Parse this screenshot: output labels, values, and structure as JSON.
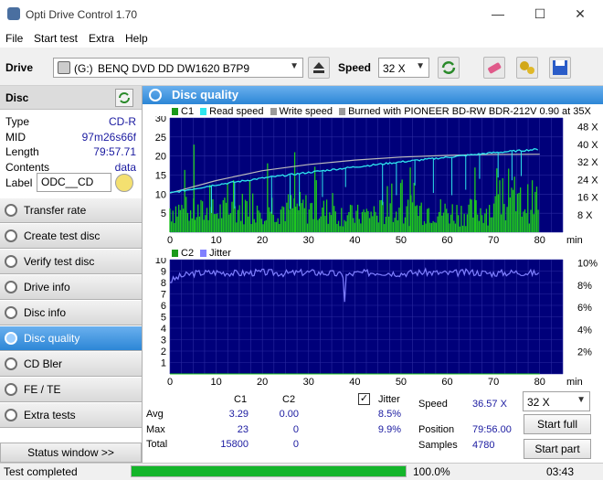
{
  "window": {
    "title": "Opti Drive Control 1.70",
    "minimize": "—",
    "maximize": "☐",
    "close": "✕"
  },
  "menu": [
    "File",
    "Start test",
    "Extra",
    "Help"
  ],
  "toolbar": {
    "drive_label": "Drive",
    "drive_letter": "(G:)",
    "drive_name": "BENQ DVD DD DW1620 B7P9",
    "speed_label": "Speed",
    "speed_value": "32 X"
  },
  "disc": {
    "header": "Disc",
    "rows": [
      {
        "key": "Type",
        "value": "CD-R"
      },
      {
        "key": "MID",
        "value": "97m26s66f"
      },
      {
        "key": "Length",
        "value": "79:57.71"
      },
      {
        "key": "Contents",
        "value": "data"
      }
    ],
    "label_key": "Label",
    "label_value": "ODC__CD"
  },
  "nav": [
    {
      "label": "Transfer rate",
      "active": false
    },
    {
      "label": "Create test disc",
      "active": false
    },
    {
      "label": "Verify test disc",
      "active": false
    },
    {
      "label": "Drive info",
      "active": false
    },
    {
      "label": "Disc info",
      "active": false
    },
    {
      "label": "Disc quality",
      "active": true
    },
    {
      "label": "CD Bler",
      "active": false
    },
    {
      "label": "FE / TE",
      "active": false
    },
    {
      "label": "Extra tests",
      "active": false
    }
  ],
  "status_window": "Status window >>",
  "panel_title": "Disc quality",
  "legend1": {
    "c1": "C1",
    "read": "Read speed",
    "write": "Write speed",
    "burned": "Burned with PIONEER BD-RW   BDR-212V 0.90 at 35X"
  },
  "legend2": {
    "c2": "C2",
    "jitter": "Jitter"
  },
  "chart_data": [
    {
      "type": "bar",
      "title": "",
      "xlabel": "min",
      "xlim": [
        0,
        80
      ],
      "ylim": [
        0,
        30
      ],
      "x_ticks": [
        0,
        10,
        20,
        30,
        40,
        50,
        60,
        70,
        80
      ],
      "y_ticks": [
        5,
        10,
        15,
        20,
        25,
        30
      ],
      "y2_ticks": [
        "8 X",
        "16 X",
        "24 X",
        "32 X",
        "40 X",
        "48 X"
      ],
      "y2lim": [
        0,
        52
      ],
      "series": [
        {
          "name": "C1",
          "color": "#1ec81e",
          "x": [
            0,
            5,
            10,
            15,
            20,
            25,
            30,
            35,
            40,
            45,
            50,
            55,
            60,
            65,
            70,
            75,
            80
          ],
          "values": [
            6,
            5,
            5,
            6,
            7,
            6,
            6,
            5,
            4,
            5,
            5,
            6,
            5,
            5,
            6,
            7,
            8
          ],
          "peaks": [
            {
              "x": 5.2,
              "y": 23
            },
            {
              "x": 27,
              "y": 21
            },
            {
              "x": 52,
              "y": 17
            },
            {
              "x": 66,
              "y": 17
            }
          ]
        },
        {
          "name": "Read speed",
          "color": "#2ee6ee",
          "x": [
            0,
            10,
            20,
            30,
            40,
            50,
            60,
            70,
            80
          ],
          "values": [
            17.8,
            21.6,
            24.6,
            27.2,
            29.7,
            32.0,
            34.1,
            36.2,
            37.8
          ]
        },
        {
          "name": "Write speed",
          "color": "#bcbcbc",
          "x": [
            0,
            10,
            20,
            30,
            40,
            50,
            60,
            70,
            80
          ],
          "values": [
            17.8,
            23.5,
            28.0,
            30.8,
            32.8,
            34.2,
            35.0,
            35.4,
            35.5
          ]
        }
      ]
    },
    {
      "type": "line",
      "title": "",
      "xlabel": "min",
      "xlim": [
        0,
        80
      ],
      "ylim": [
        0,
        10
      ],
      "x_ticks": [
        0,
        10,
        20,
        30,
        40,
        50,
        60,
        70,
        80
      ],
      "y_ticks": [
        1,
        2,
        3,
        4,
        5,
        6,
        7,
        8,
        9,
        10
      ],
      "y2_ticks": [
        "2%",
        "4%",
        "6%",
        "8%",
        "10%"
      ],
      "series": [
        {
          "name": "C2",
          "color": "#1ec81e",
          "x": [
            0,
            80
          ],
          "values": [
            0,
            0
          ]
        },
        {
          "name": "Jitter",
          "color": "#8080ff",
          "x": [
            0,
            2,
            5,
            10,
            15,
            20,
            25,
            30,
            35,
            38,
            40,
            45,
            50,
            55,
            60,
            65,
            70,
            75,
            80
          ],
          "values": [
            8.1,
            8.5,
            8.8,
            8.9,
            8.8,
            8.9,
            8.8,
            8.9,
            8.8,
            8.6,
            8.8,
            8.9,
            8.8,
            8.9,
            8.8,
            8.9,
            8.8,
            8.9,
            8.8
          ]
        }
      ]
    }
  ],
  "stats": {
    "col_c1": "C1",
    "col_c2": "C2",
    "jitter_label": "Jitter",
    "rows": [
      {
        "label": "Avg",
        "c1": "3.29",
        "c2": "0.00",
        "jitter": "8.5%"
      },
      {
        "label": "Max",
        "c1": "23",
        "c2": "0",
        "jitter": "9.9%"
      },
      {
        "label": "Total",
        "c1": "15800",
        "c2": "0",
        "jitter": ""
      }
    ],
    "speed_label": "Speed",
    "speed_value": "36.57 X",
    "position_label": "Position",
    "position_value": "79:56.00",
    "samples_label": "Samples",
    "samples_value": "4780",
    "speed_select": "32 X",
    "start_full": "Start full",
    "start_part": "Start part"
  },
  "statusbar": {
    "text": "Test completed",
    "progress": 1.0,
    "percent": "100.0%",
    "time": "03:43"
  }
}
